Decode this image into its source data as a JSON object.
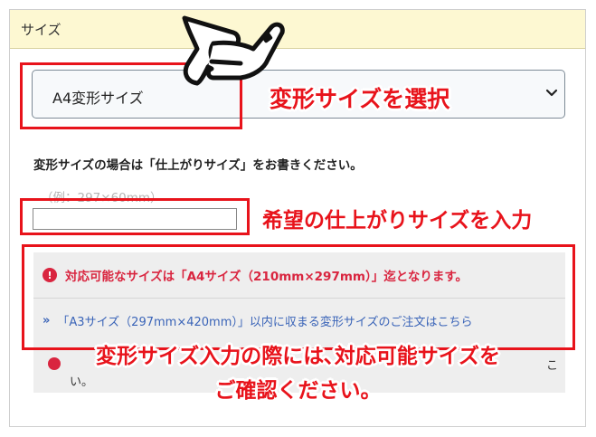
{
  "panel": {
    "header_title": "サイズ"
  },
  "select": {
    "value": "A4変形サイズ",
    "icon": "chevron-down-icon"
  },
  "form": {
    "note_label": "変形サイズの場合は「仕上がりサイズ」をお書きください。",
    "hint": "（例：297×60mm）",
    "input_value": ""
  },
  "info": {
    "alert_icon_glyph": "!",
    "alert_text": "対応可能なサイズは「A4サイズ（210mm×297mm）」迄となります。",
    "link_arrow": "»",
    "link_text": "「A3サイズ（297mm×420mm）」以内に収まる変形サイズのご注文はこちら",
    "obscured_right": "こ",
    "obscured_tail": "い。"
  },
  "annotations": {
    "select_callout": "変形サイズを選択",
    "input_callout": "希望の仕上がりサイズを入力",
    "bottom_line1": "変形サイズ入力の際には､対応可能サイズを",
    "bottom_line2": "ご確認ください。",
    "annotation_color": "#e8131b",
    "pointer_icon": "pointing-hand-icon"
  },
  "colors": {
    "header_bg": "#fdf8d2",
    "alert_red": "#d9253f",
    "link_blue": "#3a64b8"
  }
}
